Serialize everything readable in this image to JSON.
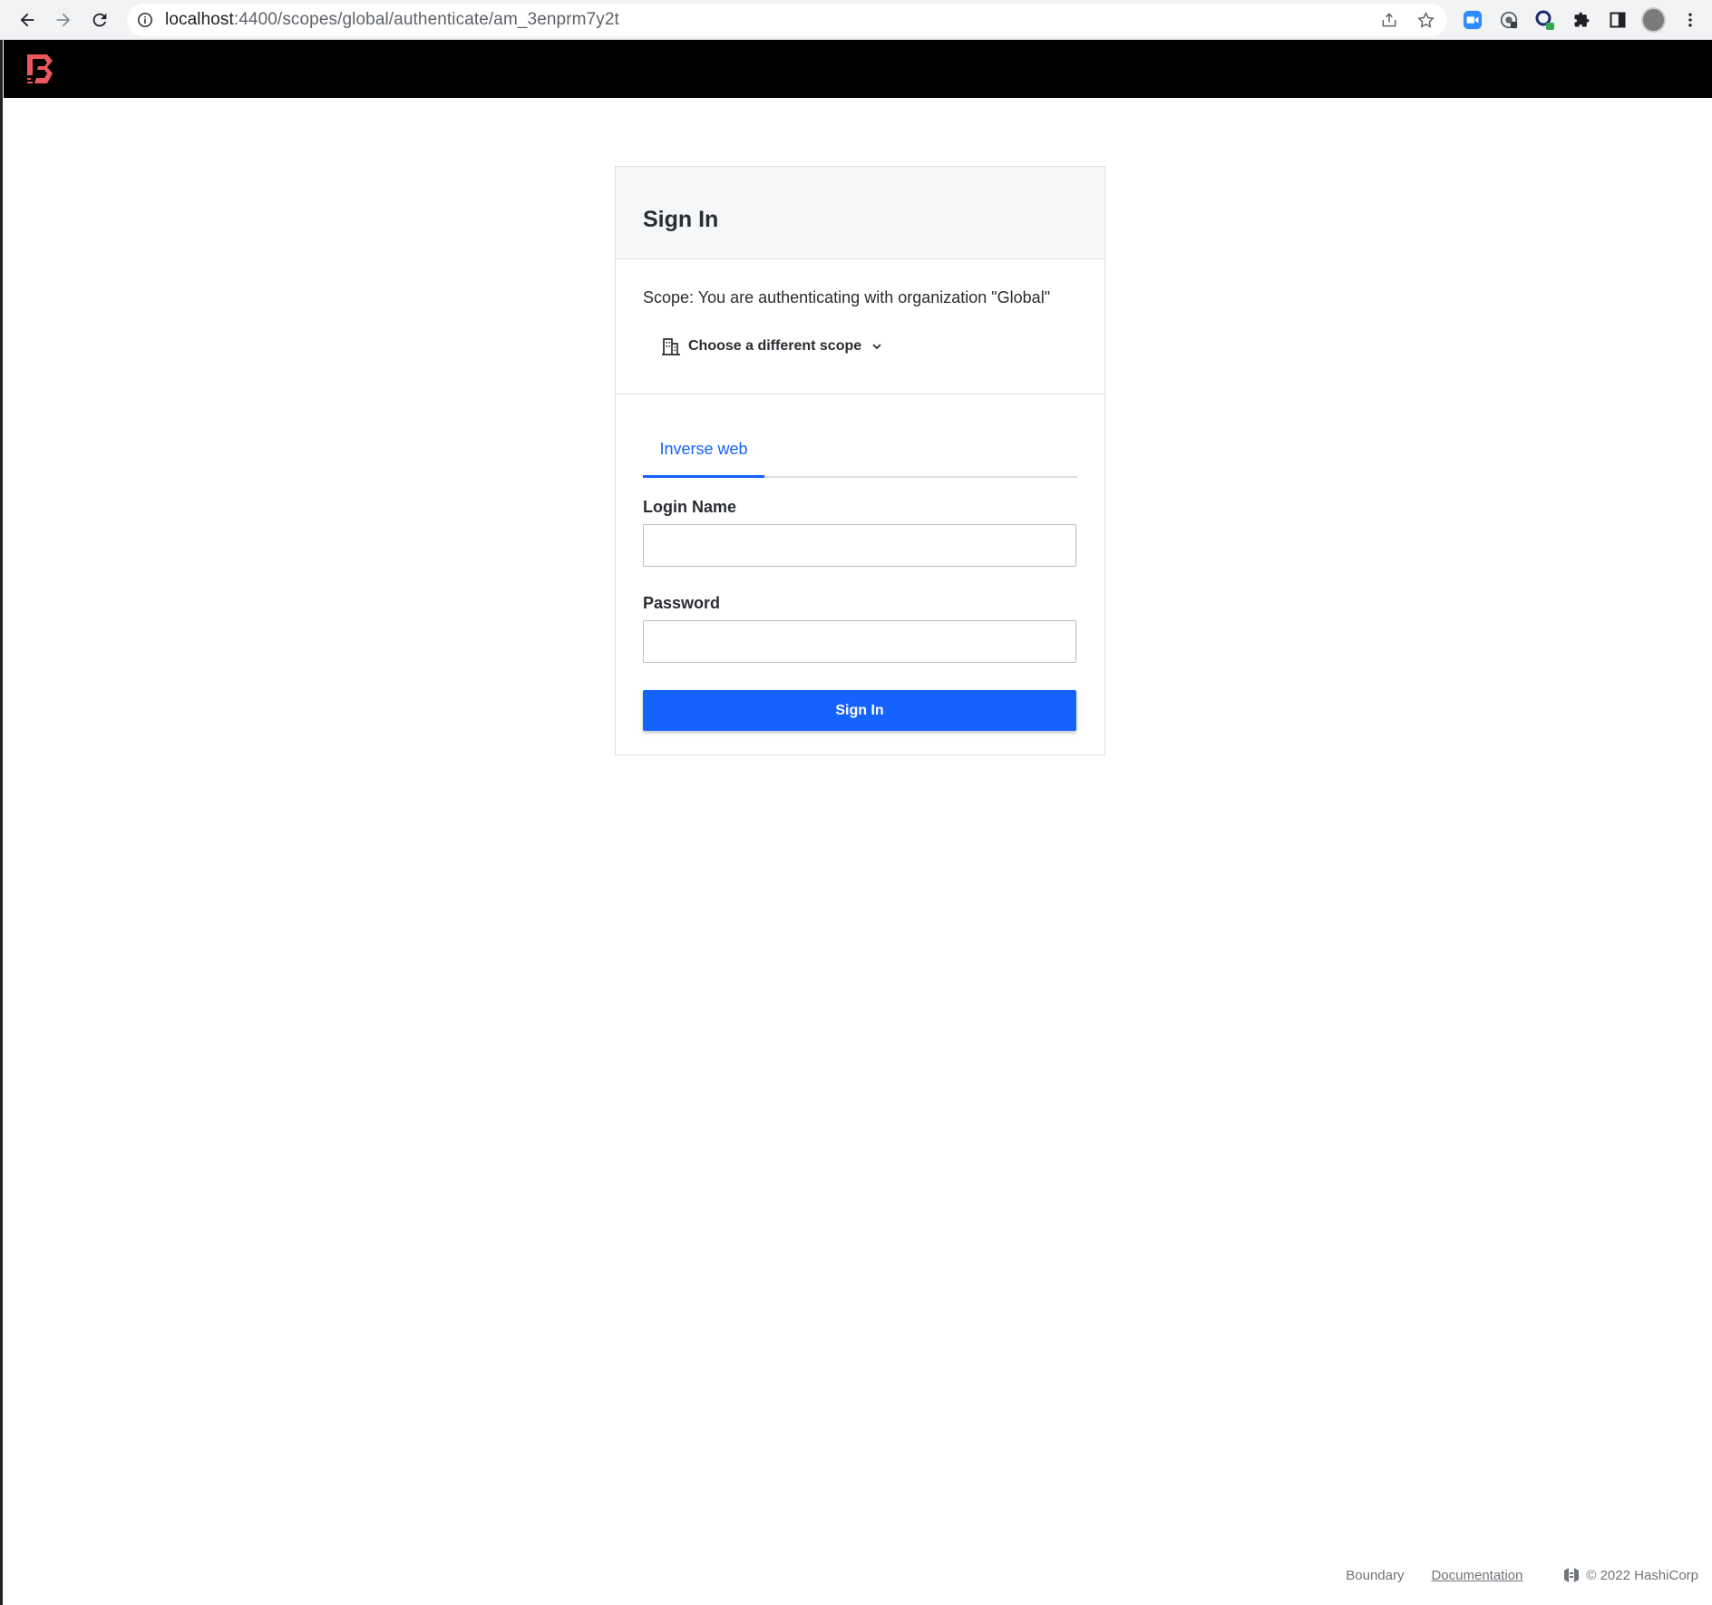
{
  "browser": {
    "url_host": "localhost",
    "url_path": ":4400/scopes/global/authenticate/am_3enprm7y2t"
  },
  "card": {
    "title": "Sign In",
    "scope_text": "Scope: You are authenticating with organization \"Global\"",
    "scope_toggle_label": "Choose a different scope",
    "tab_label": "Inverse web",
    "login_label": "Login Name",
    "login_value": "",
    "password_label": "Password",
    "password_value": "",
    "submit_label": "Sign In"
  },
  "footer": {
    "product": "Boundary",
    "docs_link": "Documentation",
    "copyright": "© 2022 HashiCorp"
  },
  "colors": {
    "accent": "#1563ff",
    "brand_red": "#ec585d",
    "header_bg": "#000000"
  }
}
